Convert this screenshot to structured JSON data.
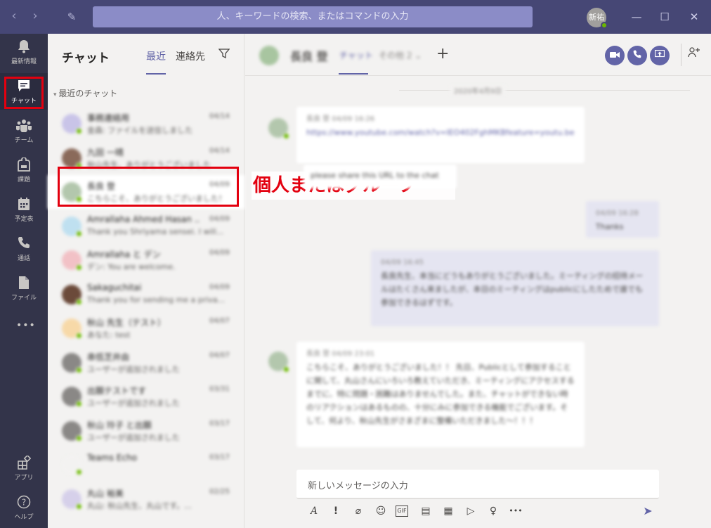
{
  "titlebar": {
    "back": "‹",
    "forward": "›",
    "compose": "✎",
    "search_placeholder": "人、キーワードの検索、またはコマンドの入力",
    "user_initials": "新祐",
    "minimize": "—",
    "maximize": "☐",
    "close": "✕"
  },
  "rail": {
    "activity": "最新情報",
    "chat": "チャット",
    "teams": "チーム",
    "assignments": "課題",
    "calendar": "予定表",
    "calls": "通話",
    "files": "ファイル",
    "more": "•••",
    "apps": "アプリ",
    "help": "ヘルプ"
  },
  "list": {
    "title": "チャット",
    "tab_recent": "最近",
    "tab_contacts": "連絡先",
    "section": "最近のチャット",
    "chats": [
      {
        "name": "事務連絡用",
        "preview": "金森: ファイルを送信しました",
        "time": "04/14",
        "color": "#c9c4e8"
      },
      {
        "name": "九田 一晴",
        "preview": "秋山先生、ありがとうございました",
        "time": "04/14",
        "color": "#8a6a5a"
      },
      {
        "name": "長良 登",
        "preview": "こちらこそ、ありがとうございました！！",
        "time": "04/09",
        "color": "#b3c7ad"
      },
      {
        "name": "Amrallaha Ahmed Hasan ...",
        "preview": "Thank you Shriyama sensei. I will...",
        "time": "04/09",
        "color": "#bfe0f0"
      },
      {
        "name": "Amrallaha と デン",
        "preview": "デン: You are welcome.",
        "time": "04/09",
        "color": "#f2c1c6"
      },
      {
        "name": "Sakaguchitai",
        "preview": "Thank you for sending me a priva...",
        "time": "04/09",
        "color": "#6b4a3a"
      },
      {
        "name": "秋山 先生（テスト）",
        "preview": "あなた: test",
        "time": "04/07",
        "color": "#f7d9a8"
      },
      {
        "name": "串低芝井由",
        "preview": "ユーザーが追加されました",
        "time": "04/07",
        "color": "#8a8886"
      },
      {
        "name": "出願テストです",
        "preview": "ユーザーが追加されました",
        "time": "03/31",
        "color": "#8a8886"
      },
      {
        "name": "秋山 玲子 と出願",
        "preview": "ユーザーが追加されました",
        "time": "03/17",
        "color": "#8a8886"
      },
      {
        "name": "Teams Echo",
        "preview": "",
        "time": "03/17",
        "color": "#f3f2f1"
      },
      {
        "name": "丸山 裕美",
        "preview": "丸山: 秋山先生、丸山です。...",
        "time": "02/25",
        "color": "#d6d0ea"
      }
    ]
  },
  "callout": {
    "text": "個人またはグループ"
  },
  "conversation": {
    "name": "長良 登",
    "tab_chat": "チャット",
    "tab_more": "その他 2 ⌄",
    "plus": "+",
    "video": "▶",
    "phone": "✆",
    "share": "⇪",
    "add_people": "⚇⁺",
    "date": "2020年4月9日",
    "messages": [
      {
        "meta": "長良 登  04/09 16:26",
        "body": "https://www.youtube.com/watch?v=IEO402FghMKBfeature=youtu.be"
      },
      {
        "meta": "",
        "body": "please share this URL to the chat"
      },
      {
        "meta": "04/09 16:28",
        "body": "Thanks"
      },
      {
        "meta": "04/09 16:45",
        "body": "長良先生、本当にどうもありがとうございました。ミーティングの招待メールはたくさん来ましたが、本日のミーティングはpublicにしたためで誰でも参加できるはずです。"
      },
      {
        "meta": "長良 登  04/09 23:01",
        "body": "こちらこそ、ありがとうございました！！ 先日、Publicとして参加することに関して、丸山さんにいろいろ教えていただき、ミーティングにアクセスするまでに、特に問題・困難はありませんでした。また、チャットができない時のリアクションはあるものの、十分にみに参加できる機能でございます。そして、何より、秋山先生がさまざまに整備いただきました〜！！！"
      }
    ],
    "composer_placeholder": "新しいメッセージの入力",
    "tools": [
      "A",
      "!",
      "⌀",
      "☺",
      "GIF",
      "▤",
      "▦",
      "▷",
      "♀",
      "•••"
    ],
    "send": "➤"
  }
}
